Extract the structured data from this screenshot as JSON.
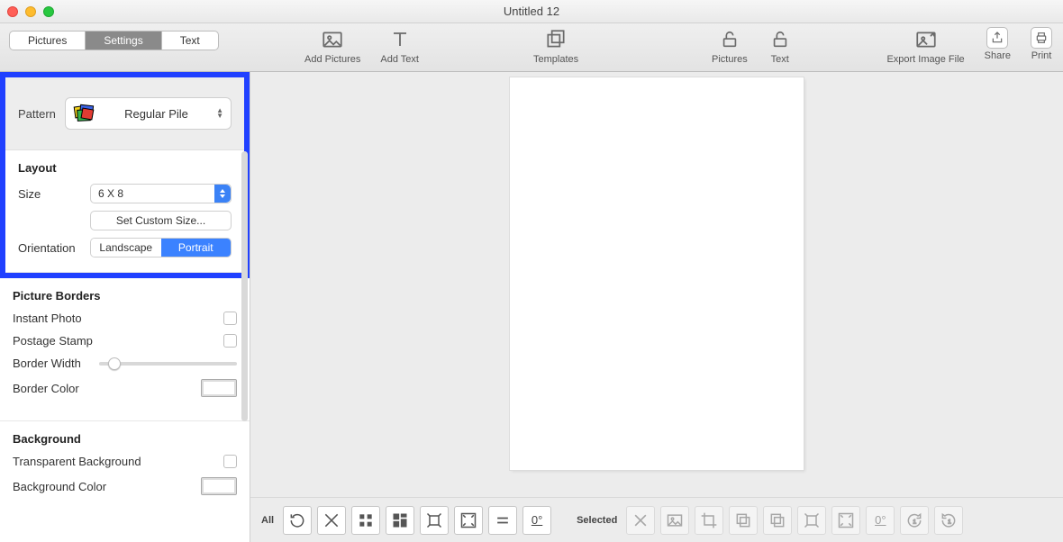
{
  "window": {
    "title": "Untitled 12"
  },
  "tabs": {
    "pictures": "Pictures",
    "settings": "Settings",
    "text": "Text",
    "active": "settings"
  },
  "toolbar": {
    "add_pictures": "Add Pictures",
    "add_text": "Add Text",
    "templates": "Templates",
    "lock_pictures": "Pictures",
    "lock_text": "Text",
    "export": "Export Image File",
    "share": "Share",
    "print": "Print"
  },
  "pattern": {
    "label": "Pattern",
    "selected": "Regular Pile"
  },
  "layout": {
    "heading": "Layout",
    "size_label": "Size",
    "size_value": "6 X 8",
    "custom_size": "Set Custom Size...",
    "orientation_label": "Orientation",
    "landscape": "Landscape",
    "portrait": "Portrait",
    "orientation_active": "portrait"
  },
  "borders": {
    "heading": "Picture Borders",
    "instant_photo": "Instant Photo",
    "postage_stamp": "Postage Stamp",
    "border_width": "Border Width",
    "border_color": "Border Color"
  },
  "background": {
    "heading": "Background",
    "transparent": "Transparent Background",
    "color": "Background Color"
  },
  "bottombar": {
    "all_label": "All",
    "selected_label": "Selected",
    "zero_deg": "0°"
  }
}
